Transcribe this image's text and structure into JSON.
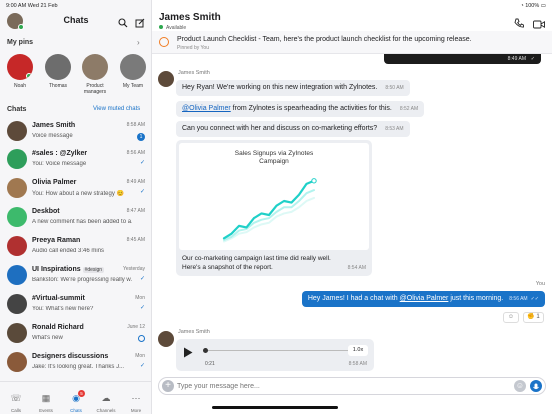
{
  "status_bar": {
    "time": "9:00 AM",
    "date": "Wed 21 Feb",
    "battery": "100%"
  },
  "sidebar": {
    "title": "Chats",
    "pins_header": "My pins",
    "pins": [
      {
        "label": "Noah",
        "color": "#c62828"
      },
      {
        "label": "Thomas",
        "color": "#6d6d6d"
      },
      {
        "label": "Product managers",
        "color": "#8d7b68"
      },
      {
        "label": "My Team",
        "color": "#7a7a7a"
      }
    ],
    "chats_header": "Chats",
    "view_muted": "View muted chats",
    "chats": [
      {
        "name": "James Smith",
        "preview": "Voice message",
        "time": "8:58 AM",
        "badge": "1",
        "color": "#5d4a3a"
      },
      {
        "name": "#sales : @Zylker",
        "preview": "You: Voice message",
        "time": "8:56 AM",
        "color": "#2e9e5b"
      },
      {
        "name": "Olivia Palmer",
        "preview": "You: How about a new strategy 😊",
        "time": "8:49 AM",
        "color": "#a07850"
      },
      {
        "name": "Deskbot",
        "preview": "A new comment has been added to a...",
        "time": "8:47 AM",
        "color": "#3dba6c"
      },
      {
        "name": "Preeya Raman",
        "preview": "Audio call ended 3:46 mins",
        "time": "8:45 AM",
        "color": "#b03030"
      },
      {
        "name": "UI Inspirations",
        "tag": "#design",
        "preview": "Bankston: We're progressing really w...",
        "time": "Yesterday",
        "color": "#1e6fc0"
      },
      {
        "name": "#Virtual-summit",
        "preview": "You: What's new here?",
        "time": "Mon",
        "color": "#444"
      },
      {
        "name": "Ronald Richard",
        "preview": "What's new",
        "time": "June 12",
        "color": "#5a4a3a"
      },
      {
        "name": "Designers discussions",
        "preview": "Jake: It's looking great. Thanks J...",
        "time": "Mon",
        "color": "#8a5a3a"
      }
    ],
    "nav": [
      {
        "label": "Calls",
        "icon": "phone-icon"
      },
      {
        "label": "Events",
        "icon": "calendar-icon"
      },
      {
        "label": "Chats",
        "icon": "chat-icon",
        "badge": "5"
      },
      {
        "label": "Channels",
        "icon": "channels-icon"
      },
      {
        "label": "More",
        "icon": "more-icon"
      }
    ]
  },
  "conversation": {
    "name": "James Smith",
    "presence": "Available",
    "pinned_text": "Product Launch Checklist - Team, here's the product launch checklist for the upcoming release.",
    "pinned_by": "Pinned by You",
    "top_card_time": "8:49 AM",
    "sender": "James Smith",
    "messages": [
      {
        "text": "Hey Ryan! We're working on this new integration with Zylnotes.",
        "time": "8:50 AM"
      },
      {
        "mention": "@Olivia Palmer",
        "text": " from Zylnotes is spearheading the activities for this.",
        "time": "8:52 AM"
      },
      {
        "text": "Can you connect with her and discuss on co-marketing efforts?",
        "time": "8:53 AM"
      }
    ],
    "chart_caption": "Our co-marketing campaign last time did really well. Here's a snapshot of the report.",
    "chart_caption_line1": "Our co-marketing campaign last time did really well.",
    "chart_caption_line2": "Here's a snapshot of the report.",
    "chart_time": "8:54 AM",
    "you_label": "You",
    "my_message_pre": "Hey James! I had a chat with ",
    "my_message_mention": "@Olivia Palmer",
    "my_message_post": " just this morning.",
    "my_message_time": "8:56 AM",
    "reaction_count": "1",
    "voice_sender": "James Smith",
    "voice_duration": "0:21",
    "voice_speed": "1.0x",
    "voice_time": "8:58 AM",
    "input_placeholder": "Type your message here..."
  },
  "chart_data": {
    "type": "line",
    "title": "Sales Signups via ZyInotes Campaign",
    "title_line1": "Sales Signups via ZyInotes",
    "title_line2": "Campaign",
    "x": [
      0,
      1,
      2,
      3,
      4,
      5,
      6,
      7,
      8,
      9,
      10,
      11,
      12
    ],
    "series": [
      {
        "values": [
          3,
          6,
          11,
          10,
          16,
          19,
          18,
          24,
          27,
          26,
          31,
          38,
          40
        ]
      },
      {
        "values": [
          2,
          4,
          8,
          9,
          13,
          15,
          16,
          20,
          23,
          23,
          27,
          32,
          34
        ]
      },
      {
        "values": [
          1,
          3,
          6,
          7,
          10,
          12,
          13,
          17,
          19,
          20,
          23,
          27,
          29
        ]
      }
    ],
    "ylim": [
      0,
      45
    ]
  },
  "colors": {
    "accent": "#1a73c8",
    "pin_orange": "#f07c22"
  }
}
